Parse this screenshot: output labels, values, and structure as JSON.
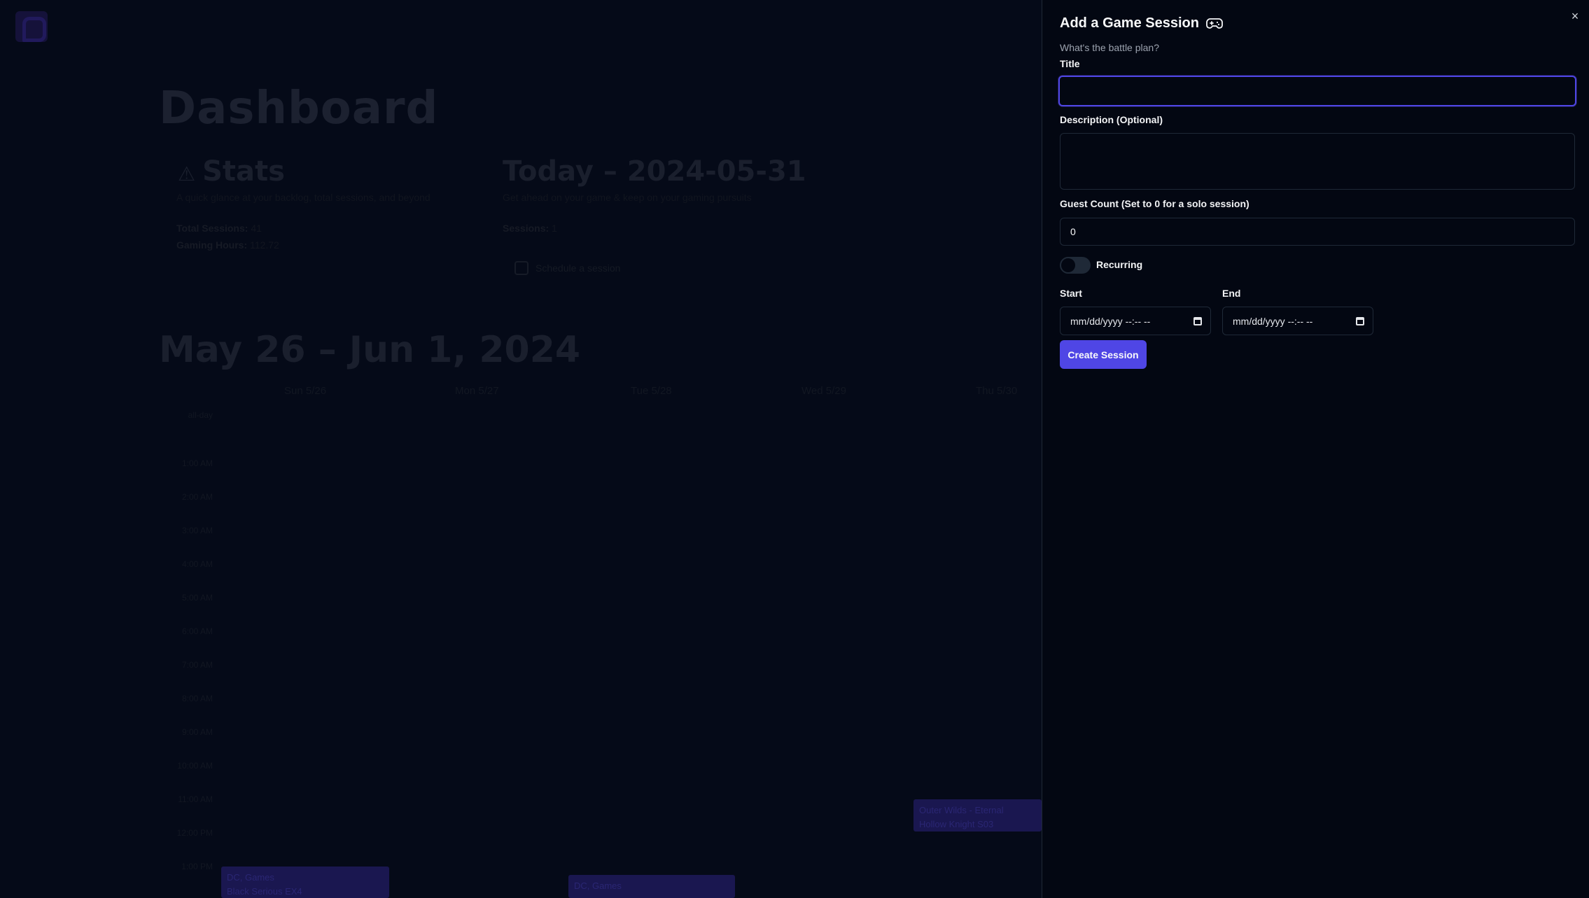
{
  "background": {
    "dashboard_title": "Dashboard",
    "stats": {
      "title": "Stats",
      "subtitle": "A quick glance at your backlog, total sessions, and beyond",
      "total_sessions_label": "Total Sessions:",
      "total_sessions_value": "41",
      "gaming_hours_label": "Gaming Hours:",
      "gaming_hours_value": "112.72"
    },
    "today": {
      "title": "Today – 2024-05-31",
      "subtitle": "Get ahead on your game & keep on your gaming pursuits",
      "sessions_label": "Sessions:",
      "sessions_value": "1",
      "schedule_button": "Schedule a session"
    },
    "calendar": {
      "range_title": "May 26 – Jun 1, 2024",
      "days": [
        "Sun 5/26",
        "Mon 5/27",
        "Tue 5/28",
        "Wed 5/29",
        "Thu 5/30"
      ],
      "all_day_label": "all-day",
      "hours": [
        "1:00 AM",
        "2:00 AM",
        "3:00 AM",
        "4:00 AM",
        "5:00 AM",
        "6:00 AM",
        "7:00 AM",
        "8:00 AM",
        "9:00 AM",
        "10:00 AM",
        "11:00 AM",
        "12:00 PM",
        "1:00 PM"
      ],
      "events": [
        {
          "title": "Outer Wilds - Eternal",
          "sub": "Hollow Knight S03"
        },
        {
          "title": "DC, Games",
          "sub": "Black Serious EX4"
        },
        {
          "title": "DC, Games",
          "sub": ""
        }
      ]
    }
  },
  "panel": {
    "title": "Add a Game Session",
    "title_icon": "gamepad-icon",
    "subtitle": "What's the battle plan?",
    "title_label": "Title",
    "title_value": "",
    "description_label": "Description (Optional)",
    "description_value": "",
    "guest_label": "Guest Count (Set to 0 for a solo session)",
    "guest_value": "0",
    "recurring_label": "Recurring",
    "recurring_on": false,
    "start_label": "Start",
    "start_placeholder": "mm/dd/yyyy --:-- --",
    "end_label": "End",
    "end_placeholder": "mm/dd/yyyy --:-- --",
    "submit_label": "Create Session",
    "close_label": "×"
  },
  "colors": {
    "accent": "#4f46e5",
    "panel_bg": "#030712",
    "overlay_bg": "#050a18",
    "border": "#1f2937"
  }
}
